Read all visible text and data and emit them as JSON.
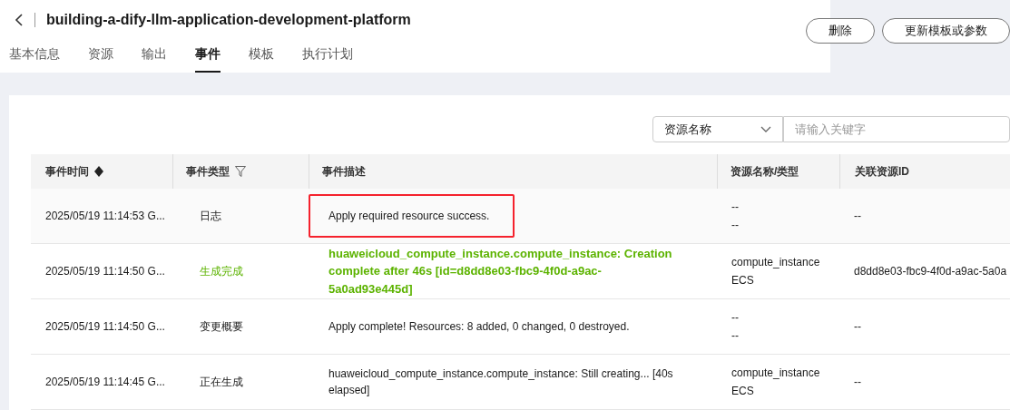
{
  "header": {
    "title": "building-a-dify-llm-application-development-platform",
    "buttons": [
      "删除",
      "更新模板或参数"
    ]
  },
  "tabs": [
    {
      "label": "基本信息",
      "selected": false
    },
    {
      "label": "资源",
      "selected": false
    },
    {
      "label": "输出",
      "selected": false
    },
    {
      "label": "事件",
      "selected": true
    },
    {
      "label": "模板",
      "selected": false
    },
    {
      "label": "执行计划",
      "selected": false
    }
  ],
  "filter": {
    "select": "资源名称",
    "placeholder": "请输入关键字"
  },
  "table": {
    "columns": [
      "事件时间",
      "事件类型",
      "事件描述",
      "资源名称/类型",
      "关联资源ID"
    ],
    "rows": [
      {
        "time": "2025/05/19 11:14:53 G...",
        "type": "日志",
        "kind": "normal",
        "highlighted": true,
        "description": "Apply required resource success.",
        "resource": [
          "--",
          "--"
        ],
        "resource_id": "--"
      },
      {
        "time": "2025/05/19 11:14:50 G...",
        "type": "生成完成",
        "kind": "success",
        "highlighted": false,
        "description": "huaweicloud_compute_instance.compute_instance: Creation complete after 46s [id=d8dd8e03-fbc9-4f0d-a9ac-5a0ad93e445d]",
        "resource": [
          "compute_instance",
          "ECS"
        ],
        "resource_id": "d8dd8e03-fbc9-4f0d-a9ac-5a0a"
      },
      {
        "time": "2025/05/19 11:14:50 G...",
        "type": "变更概要",
        "kind": "normal",
        "highlighted": false,
        "description": "Apply complete! Resources: 8 added, 0 changed, 0 destroyed.",
        "resource": [
          "--",
          "--"
        ],
        "resource_id": "--"
      },
      {
        "time": "2025/05/19 11:14:45 G...",
        "type": "正在生成",
        "kind": "normal",
        "highlighted": false,
        "description": "huaweicloud_compute_instance.compute_instance: Still creating... [40s elapsed]",
        "resource": [
          "compute_instance",
          "ECS"
        ],
        "resource_id": "--"
      }
    ]
  }
}
